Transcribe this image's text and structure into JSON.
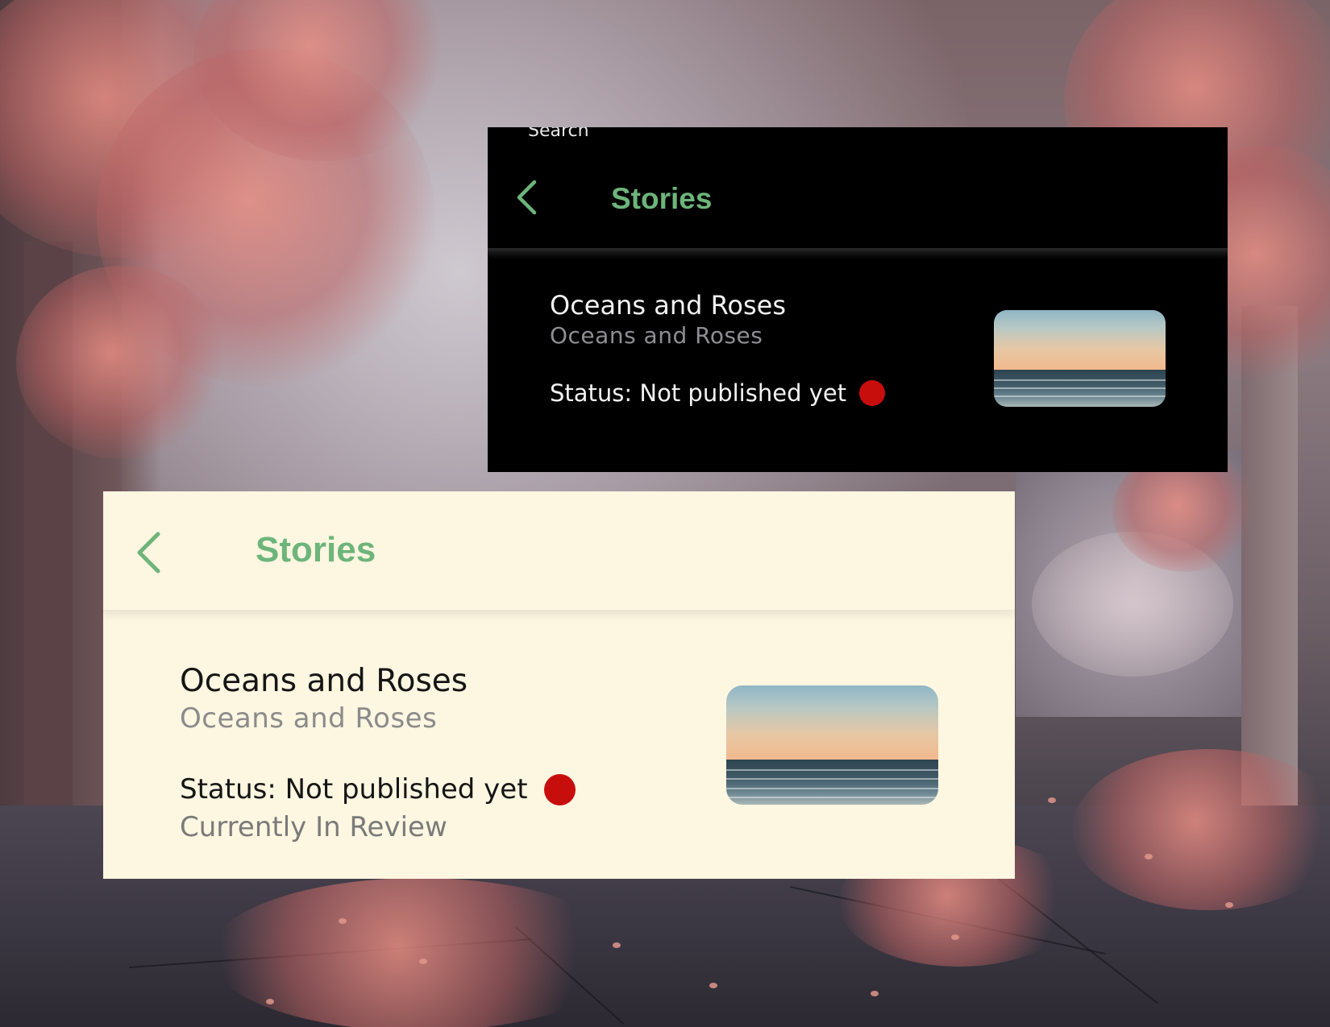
{
  "colors": {
    "accent": "#6db57a",
    "status_dot": "#c80d0d",
    "dark_background": "#000000",
    "light_background": "#fdf6e1"
  },
  "dark_panel": {
    "search_peek": "Search",
    "back_icon": "chevron-left-icon",
    "title": "Stories",
    "story": {
      "title": "Oceans and Roses",
      "subtitle": "Oceans and Roses",
      "status": "Status: Not published yet",
      "thumbnail": "ocean-sunset-thumbnail"
    }
  },
  "light_panel": {
    "back_icon": "chevron-left-icon",
    "title": "Stories",
    "story": {
      "title": "Oceans and Roses",
      "subtitle": "Oceans and Roses",
      "status": "Status: Not published yet",
      "review": "Currently In Review",
      "thumbnail": "ocean-sunset-thumbnail"
    }
  }
}
